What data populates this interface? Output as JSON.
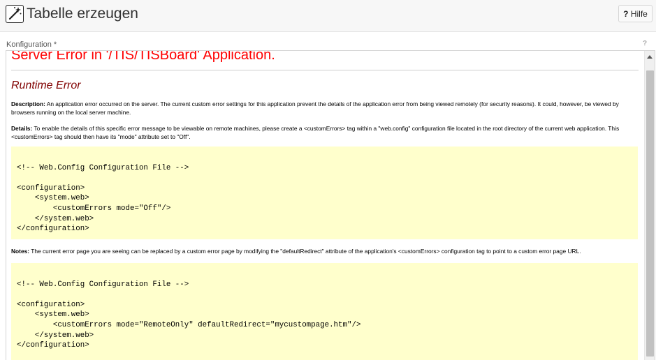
{
  "header": {
    "title": "Tabelle erzeugen",
    "icon": "magic-wand-icon",
    "help_label": "Hilfe",
    "help_icon_glyph": "?"
  },
  "field": {
    "label": "Konfiguration *",
    "help_glyph": "?"
  },
  "error_page": {
    "title": "Server Error in '/TIS/TISBoard' Application.",
    "subtitle": "Runtime Error",
    "description_label": "Description:",
    "description_text": " An application error occurred on the server. The current custom error settings for this application prevent the details of the application error from being viewed remotely (for security reasons). It could, however, be viewed by browsers running on the local server machine.",
    "details_label": "Details:",
    "details_text": " To enable the details of this specific error message to be viewable on remote machines, please create a <customErrors> tag within a \"web.config\" configuration file located in the root directory of the current web application. This <customErrors> tag should then have its \"mode\" attribute set to \"Off\".",
    "code1": [
      "",
      "<!-- Web.Config Configuration File -->",
      "",
      "<configuration>",
      "    <system.web>",
      "        <customErrors mode=\"Off\"/>",
      "    </system.web>",
      "</configuration>"
    ],
    "notes_label": "Notes:",
    "notes_text": " The current error page you are seeing can be replaced by a custom error page by modifying the \"defaultRedirect\" attribute of the application's <customErrors> configuration tag to point to a custom error page URL.",
    "code2": [
      "",
      "<!-- Web.Config Configuration File -->",
      "",
      "<configuration>",
      "    <system.web>",
      "        <customErrors mode=\"RemoteOnly\" defaultRedirect=\"mycustompage.htm\"/>",
      "    </system.web>",
      "</configuration>"
    ]
  },
  "colors": {
    "error_title": "#ff0000",
    "subtitle": "#800000",
    "code_background": "#ffffcc"
  }
}
